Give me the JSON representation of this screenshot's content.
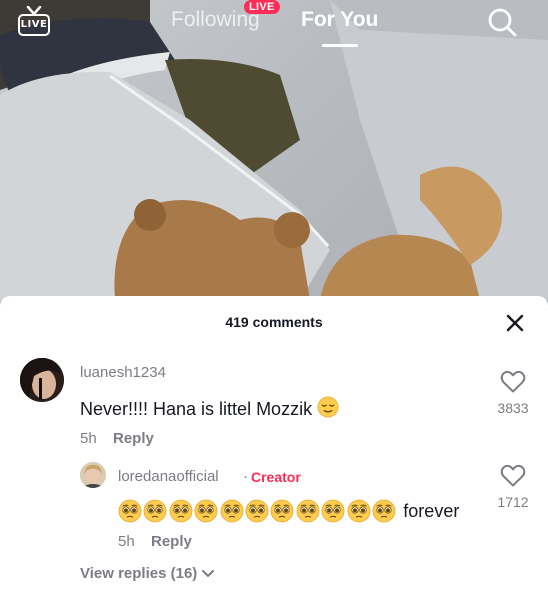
{
  "header": {
    "live_icon_label": "LIVE",
    "tabs": [
      {
        "label": "Following",
        "badge": "LIVE",
        "active": false
      },
      {
        "label": "For You",
        "active": true
      }
    ],
    "search_icon": "search-icon"
  },
  "comments_panel": {
    "title": "419 comments",
    "close_icon": "close-icon",
    "comments": [
      {
        "username": "luanesh1234",
        "text": "Never!!!! Hana is littel Mozzik",
        "emoji": "relieved-face",
        "time": "5h",
        "reply_label": "Reply",
        "likes": "3833",
        "replies": [
          {
            "username": "loredanaofficial",
            "separator": "·",
            "badge": "Creator",
            "emoji_count": 11,
            "emoji": "pleading-face",
            "text_suffix": "forever",
            "time": "5h",
            "reply_label": "Reply",
            "likes": "1712"
          }
        ],
        "view_replies_label": "View replies (16)"
      }
    ]
  },
  "colors": {
    "accent": "#fe2c55",
    "live_badge": "#ff2c55",
    "secondary_text": "#7c7d84",
    "primary_text": "#161823"
  }
}
